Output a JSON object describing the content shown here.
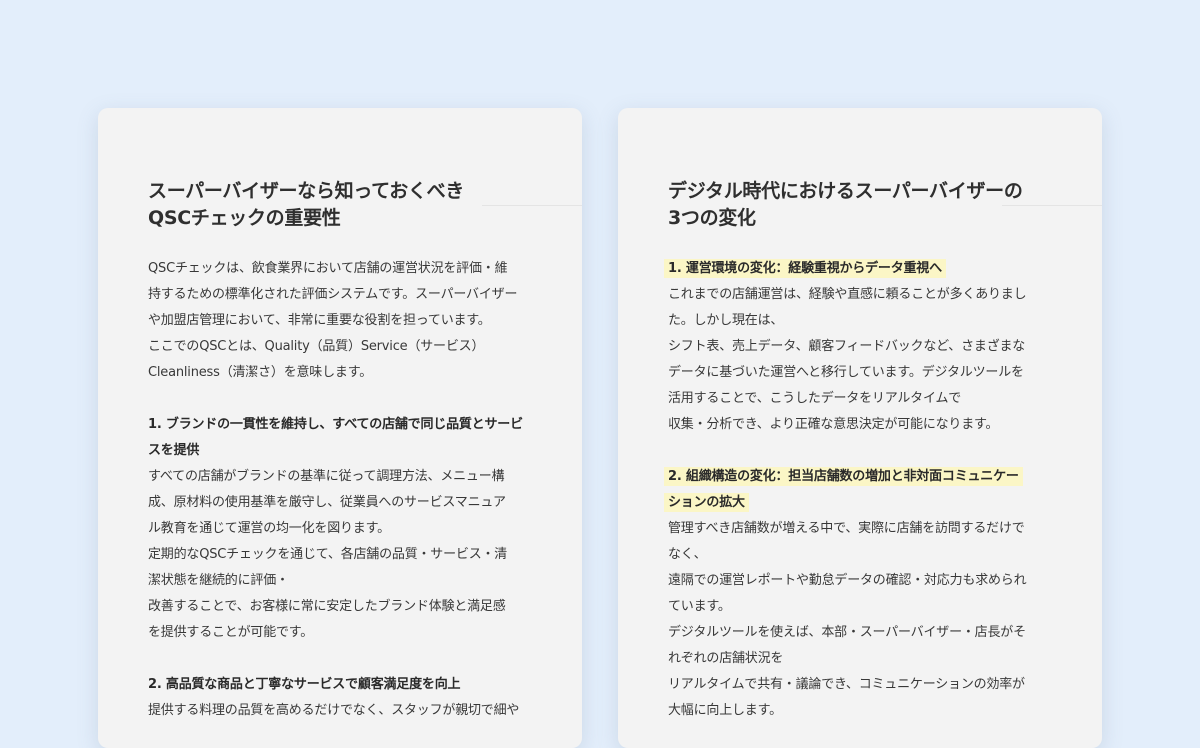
{
  "left_card": {
    "title": "スーパーバイザーなら知っておくべき\nQSCチェックの重要性",
    "intro": "QSCチェックは、飲食業界において店舗の運営状況を評価・維\n持するための標準化された評価システムです。スーパーバイザー\nや加盟店管理において、非常に重要な役割を担っています。\n ここでのQSCとは、Quality（品質）Service（サービス）\nCleanliness（清潔さ）を意味します。",
    "sections": [
      {
        "heading": "1. ブランドの一貫性を維持し、すべての店舗で同じ品質とサービ\nスを提供",
        "body": "すべての店舗がブランドの基準に従って調理方法、メニュー構\n成、原材料の使用基準を厳守し、従業員へのサービスマニュア\nル教育を通じて運営の均一化を図ります。\n 定期的なQSCチェックを通じて、各店舗の品質・サービス・清\n潔状態を継続的に評価・\n改善することで、お客様に常に安定したブランド体験と満足感\nを提供することが可能です。"
      },
      {
        "heading": "2. 高品質な商品と丁寧なサービスで顧客満足度を向上",
        "body": "提供する料理の品質を高めるだけでなく、スタッフが親切で細や"
      }
    ]
  },
  "right_card": {
    "title": "デジタル時代におけるスーパーバイザーの\n3つの変化",
    "sections": [
      {
        "heading": "1. 運営環境の変化：経験重視からデータ重視へ",
        "body": "これまでの店舗運営は、経験や直感に頼ることが多くありまし\nた。しかし現在は、\nシフト表、売上データ、顧客フィードバックなど、さまざまな\nデータに基づいた運営へと移行しています。デジタルツールを\n活用することで、こうしたデータをリアルタイムで\n収集・分析でき、より正確な意思決定が可能になります。"
      },
      {
        "heading": "2. 組織構造の変化：担当店舗数の増加と非対面コミュニケー\nションの拡大",
        "body": "管理すべき店舗数が増える中で、実際に店舗を訪問するだけで\nなく、\n遠隔での運営レポートや勤怠データの確認・対応力も求められ\nています。\nデジタルツールを使えば、本部・スーパーバイザー・店長がそ\nれぞれの店舗状況を\nリアルタイムで共有・議論でき、コミュニケーションの効率が\n大幅に向上します。"
      }
    ]
  }
}
